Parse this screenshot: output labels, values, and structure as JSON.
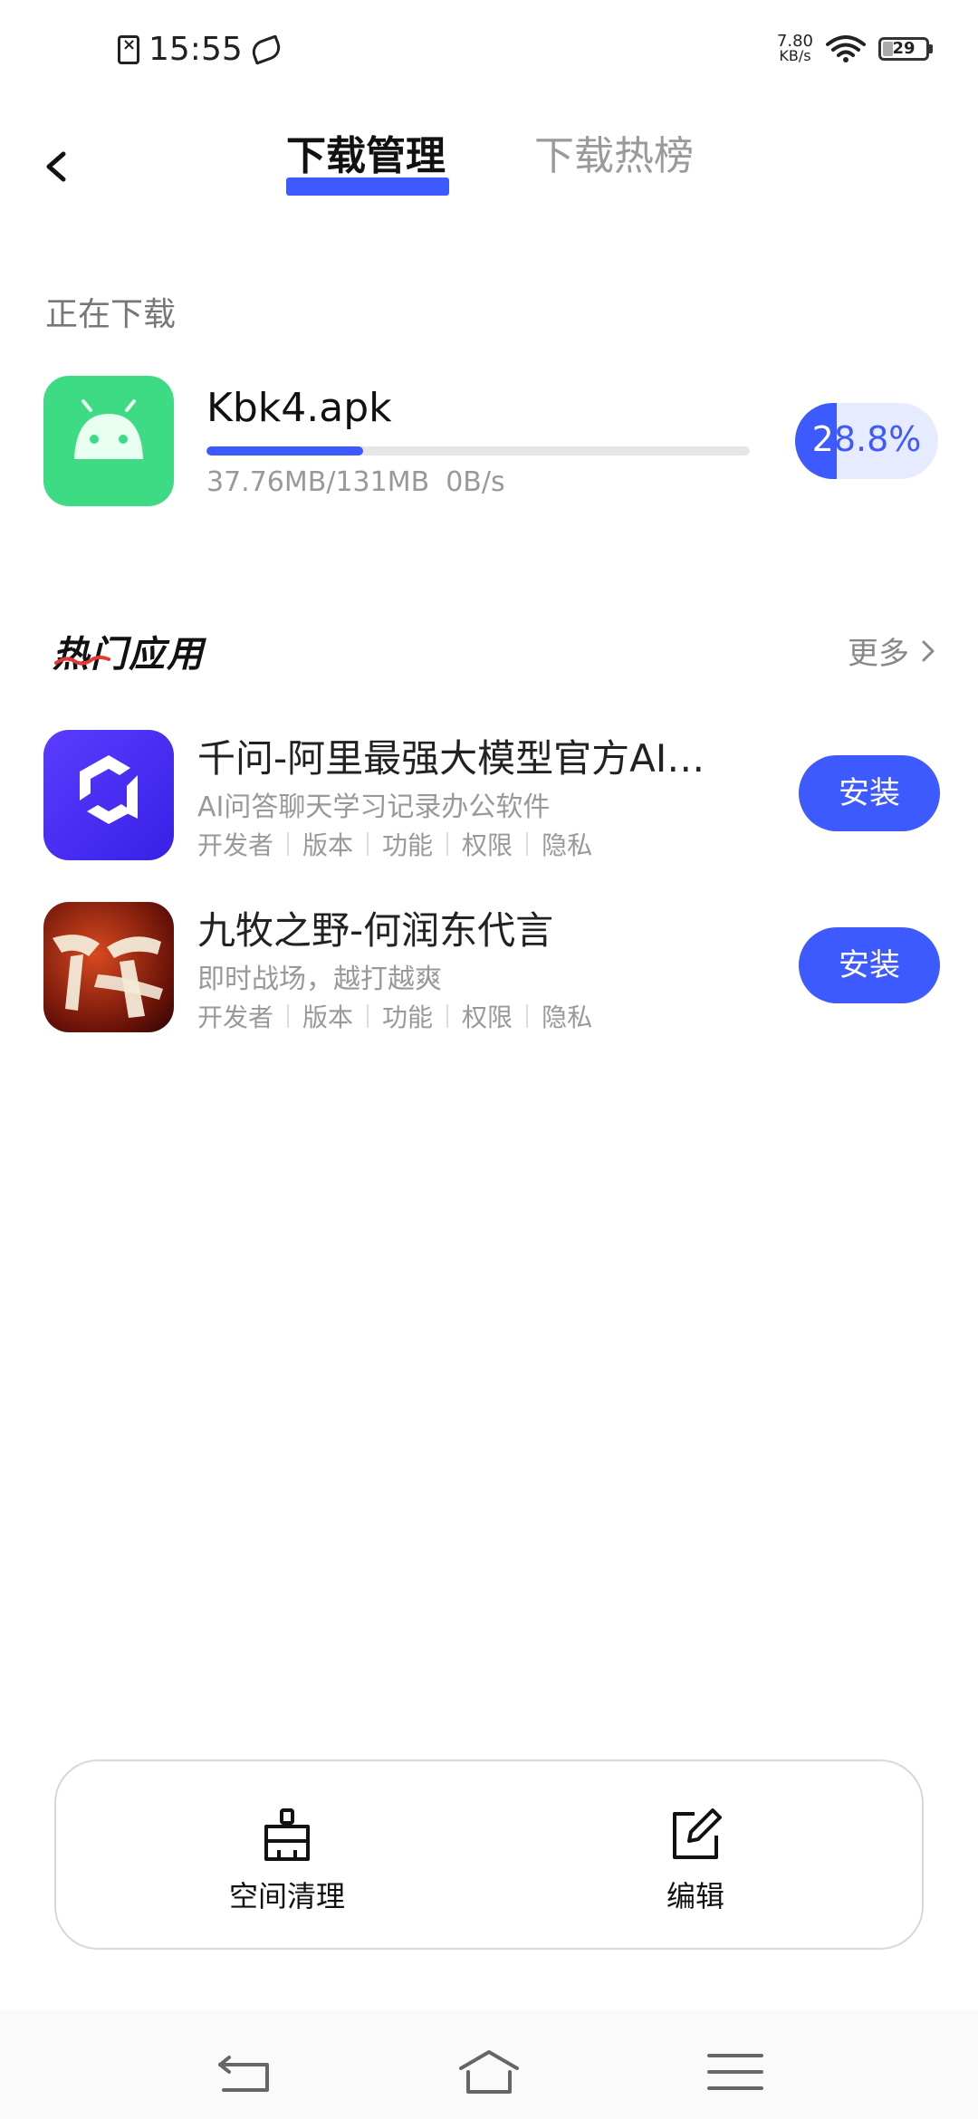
{
  "status_bar": {
    "time": "15:55",
    "net_speed_value": "7.80",
    "net_speed_unit": "KB/s",
    "battery_level": "29"
  },
  "header": {
    "tabs": [
      {
        "label": "下载管理",
        "active": true
      },
      {
        "label": "下载热榜",
        "active": false
      }
    ]
  },
  "downloading": {
    "section_title": "正在下载",
    "item": {
      "name": "Kbk4.apk",
      "size_progress": "37.76MB/131MB",
      "speed": "0B/s",
      "percent_label": "28.8%",
      "progress": 0.288,
      "icon": "android-icon"
    }
  },
  "popular": {
    "title": "热门应用",
    "more_label": "更多",
    "apps": [
      {
        "name": "千问-阿里最强大模型官方AI…",
        "description": "AI问答聊天学习记录办公软件",
        "links": [
          "开发者",
          "版本",
          "功能",
          "权限",
          "隐私"
        ],
        "install_label": "安装",
        "icon": "qianwen-icon"
      },
      {
        "name": "九牧之野-何润东代言",
        "description": "即时战场，越打越爽",
        "links": [
          "开发者",
          "版本",
          "功能",
          "权限",
          "隐私"
        ],
        "install_label": "安装",
        "icon": "jiumu-icon"
      }
    ]
  },
  "actions": {
    "clean_label": "空间清理",
    "edit_label": "编辑"
  },
  "colors": {
    "accent": "#3d5afe",
    "android_green": "#3ddc84"
  }
}
